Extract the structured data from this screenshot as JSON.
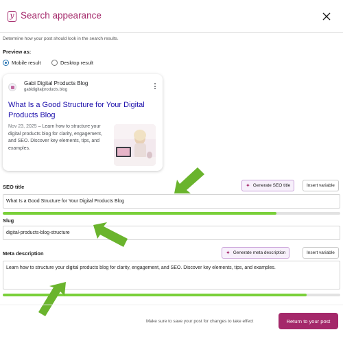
{
  "modal": {
    "title": "Search appearance",
    "description": "Determine how your post should look in the search results.",
    "preview_as_label": "Preview as:",
    "options": [
      "Mobile result",
      "Desktop result"
    ],
    "selected_option": "Mobile result"
  },
  "serp": {
    "site_name": "Gabi Digital Products Blog",
    "site_url": "gabidigitalproducts.blog",
    "title": "What Is a Good Structure for Your Digital Products Blog",
    "date": "Nov 23, 2025",
    "separator": " – ",
    "description": "Learn how to structure your digital products blog for clarity, engagement, and SEO. Discover key elements, tips, and examples."
  },
  "seo_title": {
    "label": "SEO title",
    "generate_label": "Generate SEO title",
    "insert_label": "Insert variable",
    "value": "What Is a Good Structure for Your Digital Products Blog",
    "progress": 0.81
  },
  "slug": {
    "label": "Slug",
    "value": "digital-products-blog-structure"
  },
  "meta_description": {
    "label": "Meta description",
    "generate_label": "Generate meta description",
    "insert_label": "Insert variable",
    "value": "Learn how to structure your digital products blog for clarity, engagement, and SEO. Discover key elements, tips, and examples.",
    "progress": 0.9
  },
  "footer": {
    "note": "Make sure to save your post for changes to take effect",
    "return_label": "Return to your post"
  },
  "icons": {
    "logo": "yoast-logo-icon",
    "close": "close-icon",
    "menu": "kebab-menu-icon",
    "sparkle": "sparkle-icon",
    "annotation": "green-arrow-icon"
  },
  "colors": {
    "brand": "#a4286a",
    "link": "#1a0dab",
    "progress_good": "#7ad03a",
    "radio_selected": "#2271b1",
    "annotation_arrow": "#6ab42d"
  }
}
